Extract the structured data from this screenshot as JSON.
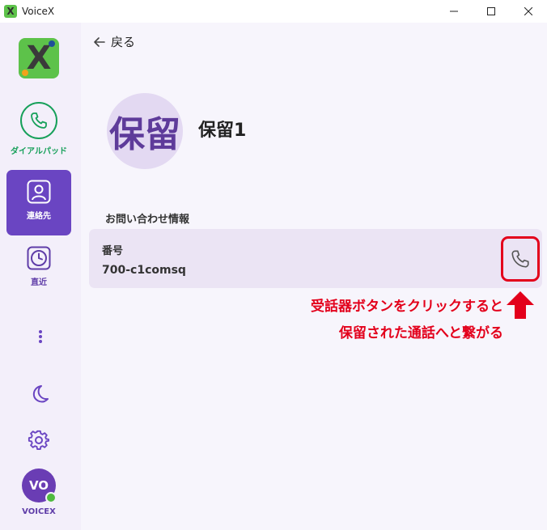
{
  "window": {
    "title": "VoiceX",
    "app_icon_letter": "X"
  },
  "sidebar": {
    "logo_letter": "X",
    "items": [
      {
        "label": "ダイアルパッド",
        "icon": "phone-icon"
      },
      {
        "label": "連絡先",
        "icon": "contact-icon"
      },
      {
        "label": "直近",
        "icon": "clock-icon"
      }
    ],
    "more_icon": "more-vertical-icon",
    "theme_icon": "moon-icon",
    "settings_icon": "gear-icon",
    "avatar_initials": "VO",
    "avatar_label": "VOICEX"
  },
  "main": {
    "back_label": "戻る",
    "contact": {
      "avatar_text": "保留",
      "name": "保留1"
    },
    "section_title": "お問い合わせ情報",
    "field": {
      "label": "番号",
      "value": "700-c1comsq"
    },
    "annotation": {
      "line1": "受話器ボタンをクリックすると",
      "line2": "保留された通話へと繋がる"
    }
  },
  "colors": {
    "accent": "#6a45c2",
    "dialpad_green": "#17a05a",
    "annotation_red": "#e3001b",
    "logo_green": "#5dc24a",
    "presence_green": "#4fba3f"
  }
}
